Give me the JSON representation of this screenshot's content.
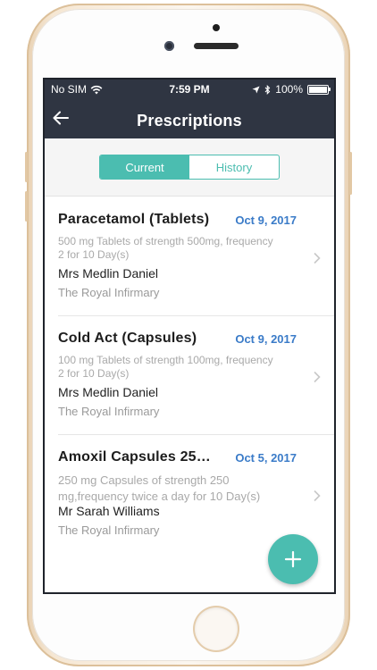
{
  "status_bar": {
    "carrier": "No SIM",
    "time": "7:59 PM",
    "battery": "100%"
  },
  "nav": {
    "title": "Prescriptions"
  },
  "tabs": [
    {
      "label": "Current",
      "selected": true
    },
    {
      "label": "History",
      "selected": false
    }
  ],
  "prescriptions": [
    {
      "name": "Paracetamol (Tablets)",
      "date": "Oct 9, 2017",
      "description": "500 mg Tablets of strength 500mg, frequency 2 for 10 Day(s)",
      "doctor": "Mrs Medlin Daniel",
      "hospital": "The Royal Infirmary"
    },
    {
      "name": "Cold Act (Capsules)",
      "date": "Oct 9, 2017",
      "description": "100 mg Tablets of strength 100mg, frequency 2 for 10 Day(s)",
      "doctor": "Mrs Medlin Daniel",
      "hospital": "The Royal Infirmary"
    },
    {
      "name": "Amoxil Capsules 250 ...",
      "date": "Oct 5, 2017",
      "description": "250 mg Capsules of strength 250 mg,frequency twice a day for 10 Day(s)",
      "doctor": "Mr Sarah Williams",
      "hospital": "The Royal Infirmary"
    }
  ],
  "fab": {
    "icon": "plus-icon"
  },
  "colors": {
    "accent": "#4bbdb0",
    "header": "#2f3542",
    "date": "#3a7bc8"
  }
}
